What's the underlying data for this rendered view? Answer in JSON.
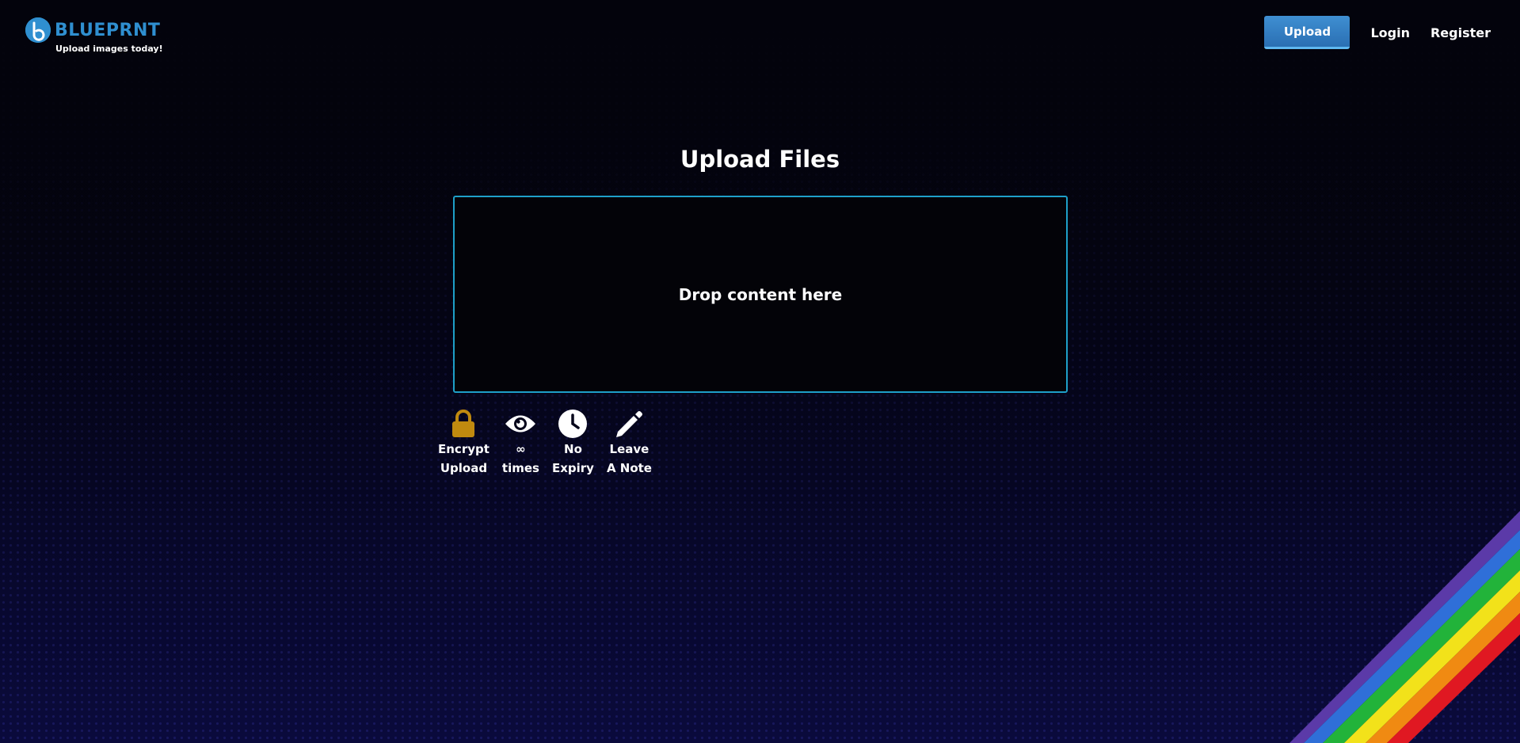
{
  "brand": {
    "name": "BLUEPRNT",
    "tagline": "Upload images today!",
    "logo_icon": "b-letter-icon",
    "color": "#2f8fd0"
  },
  "nav": {
    "upload_label": "Upload",
    "login_label": "Login",
    "register_label": "Register"
  },
  "main": {
    "title": "Upload Files",
    "dropzone_text": "Drop content here"
  },
  "options": [
    {
      "icon": "lock-icon",
      "line1": "Encrypt",
      "line2": "Upload",
      "color": "#c08a0f"
    },
    {
      "icon": "eye-icon",
      "line1": "∞",
      "line2": "times",
      "color": "#ffffff"
    },
    {
      "icon": "clock-icon",
      "line1": "No",
      "line2": "Expiry",
      "color": "#ffffff"
    },
    {
      "icon": "pencil-icon",
      "line1": "Leave",
      "line2": "A Note",
      "color": "#ffffff"
    }
  ],
  "colors": {
    "accent": "#1ea0c8",
    "button": "#3f8fd2",
    "rainbow": [
      "#5b3aa8",
      "#2f6fd8",
      "#22b33a",
      "#f2e21a",
      "#f08a12",
      "#e01822"
    ]
  }
}
